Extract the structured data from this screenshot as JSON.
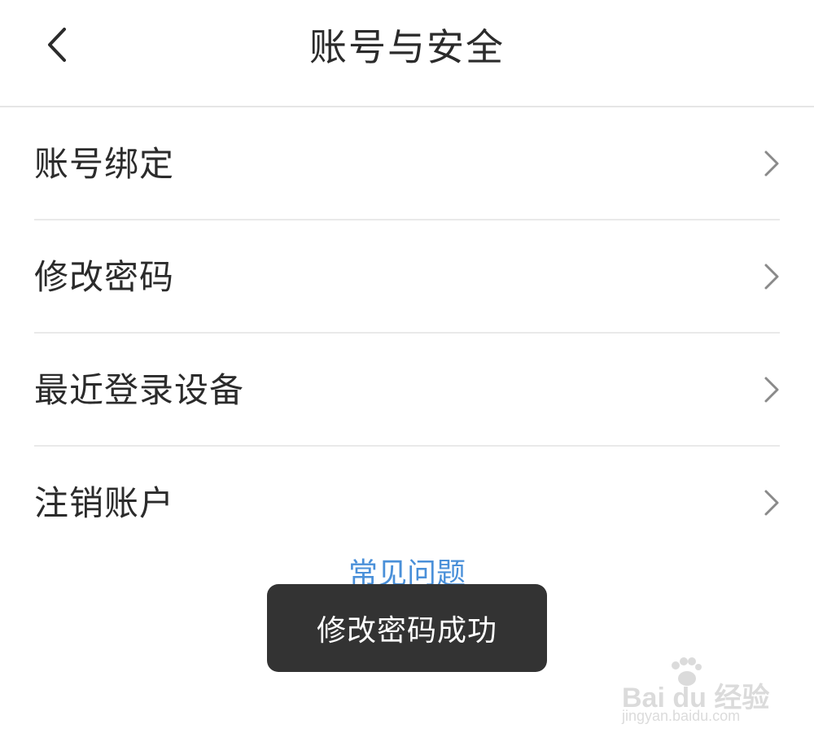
{
  "header": {
    "title": "账号与安全"
  },
  "menu": {
    "items": [
      {
        "label": "账号绑定"
      },
      {
        "label": "修改密码"
      },
      {
        "label": "最近登录设备"
      },
      {
        "label": "注销账户"
      }
    ]
  },
  "faq": {
    "label": "常见问题"
  },
  "toast": {
    "message": "修改密码成功"
  },
  "watermark": {
    "brand": "Bai du 经验",
    "url": "jingyan.baidu.com"
  },
  "colors": {
    "link": "#4a90d9",
    "toast_bg": "#333333",
    "divider": "#e9e9e9"
  },
  "icons": {
    "back": "chevron-left-icon",
    "row": "chevron-right-icon"
  }
}
